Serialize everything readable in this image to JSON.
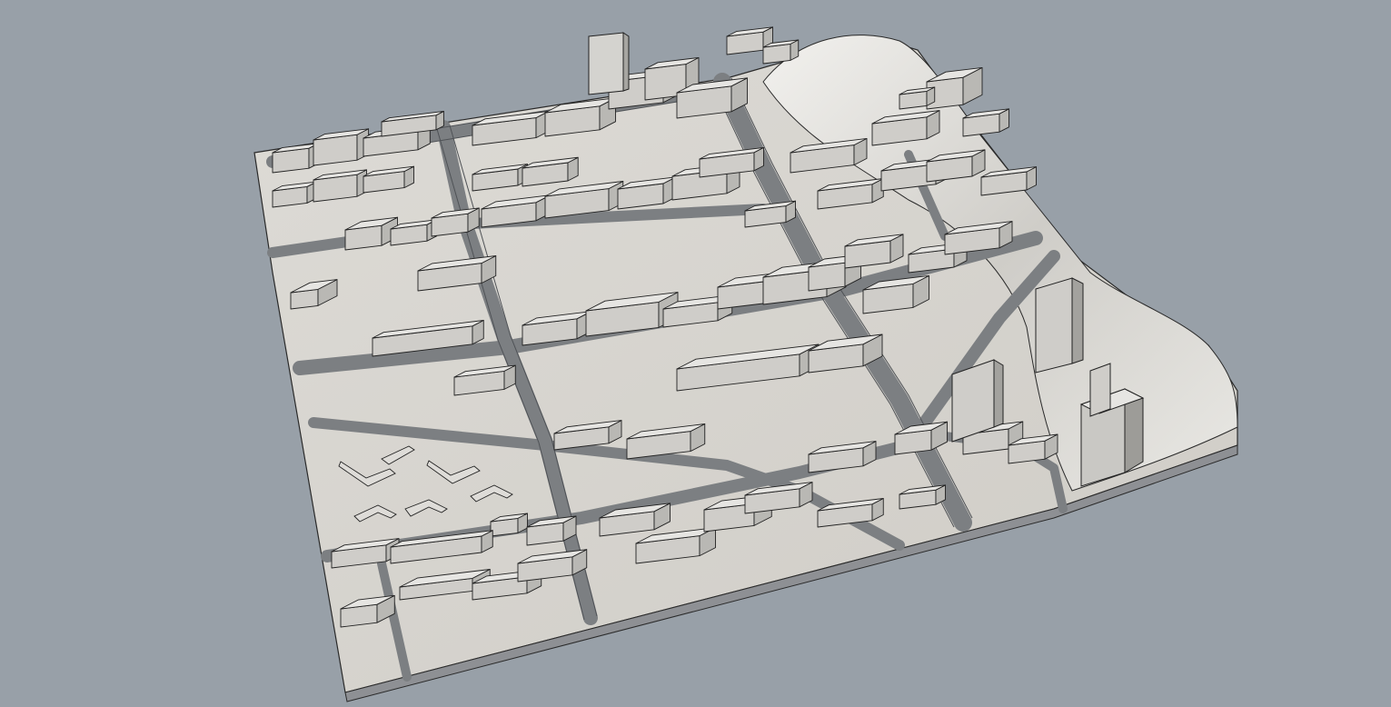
{
  "viewport": {
    "background": "#98a0a8",
    "kind": "3d-city-model-perspective"
  },
  "colors": {
    "ground": "#d9d7d2",
    "ground_shadow": "#c4c2bc",
    "road": "#7c7f82",
    "road_edge": "#5e6164",
    "building_top": "#e6e5e2",
    "building_side": "#b9b8b4",
    "building_front": "#cfcdc9",
    "terrain": "#e4e3df",
    "outline": "#1e1e1e"
  }
}
